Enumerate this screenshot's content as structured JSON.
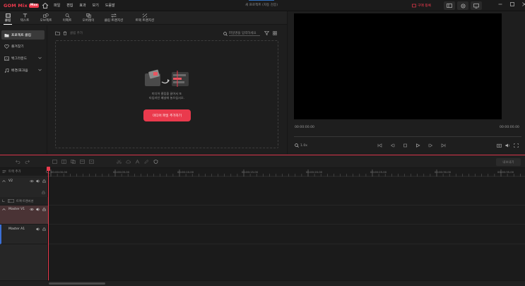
{
  "app": {
    "brand": "GOM Mix",
    "edition_badge": "Max",
    "document_title": "새 프로젝트 (자동 검증)",
    "menu": [
      "파일",
      "편집",
      "효과",
      "보기",
      "도움말"
    ],
    "upgrade_label": "구매 등록"
  },
  "tabs": [
    {
      "label": "클립",
      "icon": "film-icon"
    },
    {
      "label": "텍스트",
      "icon": "text-icon"
    },
    {
      "label": "오브젝트",
      "icon": "shapes-icon"
    },
    {
      "label": "이펙트",
      "icon": "magic-icon"
    },
    {
      "label": "오버레이",
      "icon": "overlay-icon"
    },
    {
      "label": "클립 트랜지션",
      "icon": "transition-icon"
    },
    {
      "label": "트랙 트랜지션",
      "icon": "track-transition-icon"
    }
  ],
  "sidenav": [
    {
      "label": "프로젝트 클립",
      "icon": "folder-icon"
    },
    {
      "label": "즐겨찾기",
      "icon": "heart-icon"
    },
    {
      "label": "백그라운드",
      "icon": "image-icon"
    },
    {
      "label": "배경/효과음",
      "icon": "music-icon"
    }
  ],
  "media": {
    "toolbar_label": "클립 추가",
    "search_placeholder": "파일명을 입력하세요",
    "drop_text_line1": "미디어 클립을 끌어서 또",
    "drop_text_line2": "타임라인 패널에 놓으십시오.",
    "add_button": "미디어 파일 추가하기"
  },
  "preview": {
    "time_current": "00:00:00.00",
    "time_total": "00:00:00.00",
    "zoom": "1.0x"
  },
  "timeline": {
    "export_label": "내보내기",
    "add_track": "트랙 추가",
    "ruler": [
      "00:00:00.00",
      "00:00:05.00",
      "00:00:10.00",
      "00:00:15.00",
      "00:00:20.00",
      "00:00:25.00",
      "00:00:30.00",
      "00:00:35.00"
    ],
    "tracks": [
      {
        "name": "V2",
        "sub": "트랙 트랜지션"
      },
      {
        "name": "Master V1"
      },
      {
        "name": "Master A1"
      }
    ]
  },
  "colors": {
    "accent": "#ea3a4d",
    "background": "#1e1e1e",
    "preview": "#000000"
  }
}
